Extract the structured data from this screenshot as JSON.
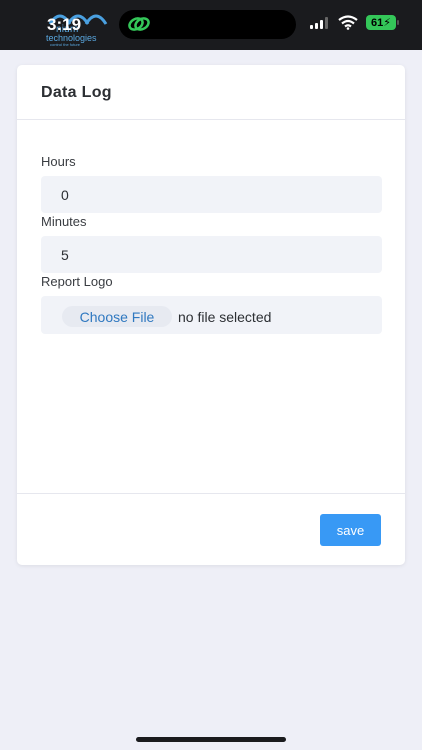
{
  "status_bar": {
    "time": "3:19",
    "battery": "61",
    "logo_name": "nium",
    "logo_sub": "technologies",
    "logo_tag": "control the future"
  },
  "card": {
    "title": "Data Log",
    "fields": [
      {
        "label": "Hours",
        "value": "0"
      },
      {
        "label": "Minutes",
        "value": "5"
      }
    ],
    "report_logo": {
      "label": "Report Logo",
      "button": "Choose File",
      "status": "no file selected"
    },
    "save_label": "save"
  },
  "colors": {
    "accent": "#3899f5",
    "background": "#eeeff7",
    "field_bg": "#f1f3f8",
    "battery": "#34c759"
  }
}
